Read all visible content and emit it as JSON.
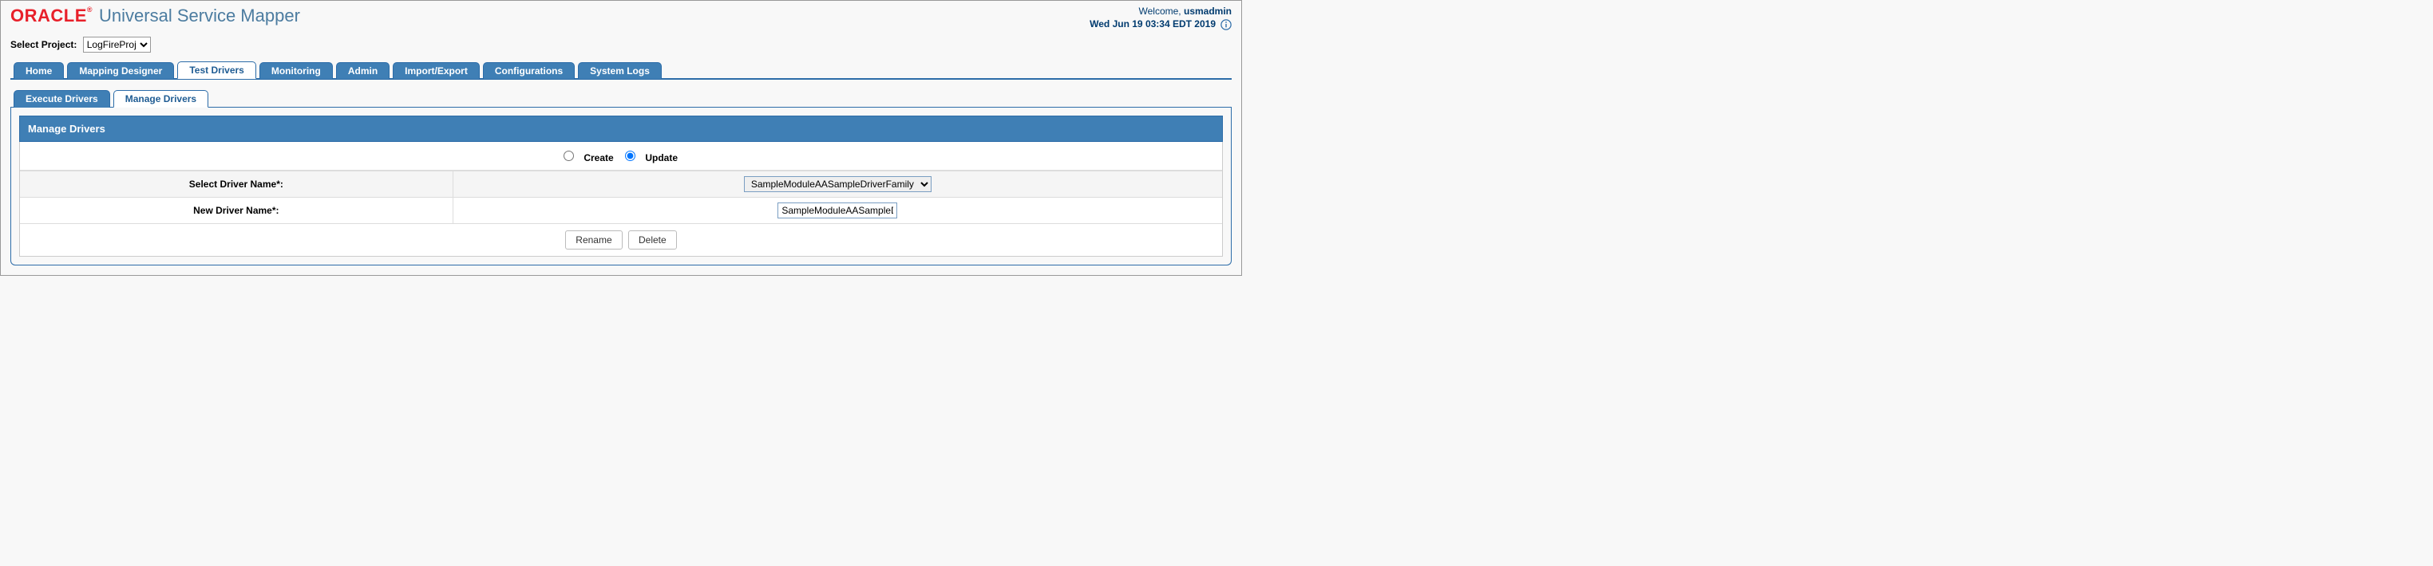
{
  "header": {
    "logo_text": "ORACLE",
    "logo_reg": "®",
    "app_title": "Universal Service Mapper",
    "welcome_label": "Welcome, ",
    "username": "usmadmin",
    "timestamp": "Wed Jun 19 03:34 EDT 2019"
  },
  "project": {
    "label": "Select Project:",
    "selected": "LogFireProj"
  },
  "tabs": {
    "home": "Home",
    "mapping_designer": "Mapping Designer",
    "test_drivers": "Test Drivers",
    "monitoring": "Monitoring",
    "admin": "Admin",
    "import_export": "Import/Export",
    "configurations": "Configurations",
    "system_logs": "System Logs"
  },
  "subtabs": {
    "execute": "Execute Drivers",
    "manage": "Manage Drivers"
  },
  "panel": {
    "title": "Manage Drivers",
    "radio_create": "Create",
    "radio_update": "Update",
    "select_driver_label": "Select Driver Name*:",
    "select_driver_value": "SampleModuleAASampleDriverFamily",
    "new_driver_label": "New Driver Name*:",
    "new_driver_value": "SampleModuleAASampleD",
    "rename_btn": "Rename",
    "delete_btn": "Delete"
  }
}
